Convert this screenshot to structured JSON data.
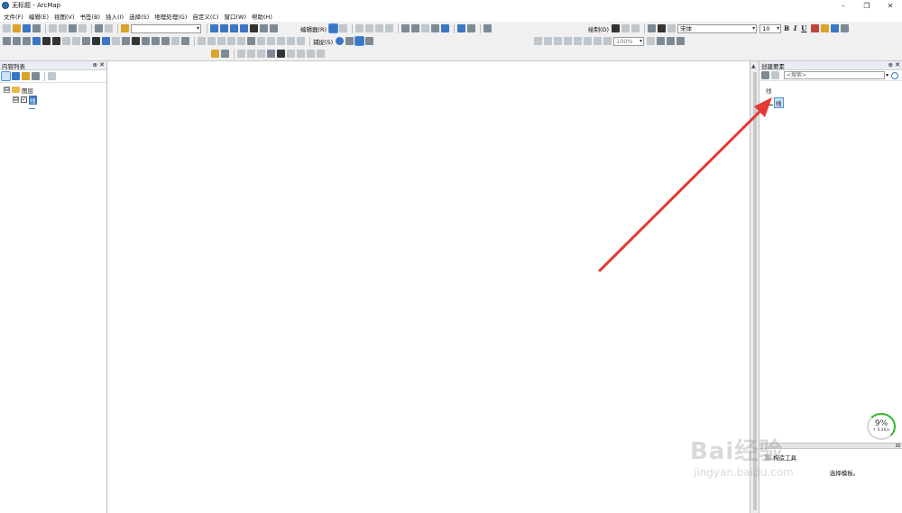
{
  "window": {
    "title": "无标题 - ArcMap",
    "minimize": "–",
    "restore": "❐",
    "close": "✕"
  },
  "menubar": [
    {
      "label": "文件(F)"
    },
    {
      "label": "编辑(E)"
    },
    {
      "label": "视图(V)"
    },
    {
      "label": "书签(B)"
    },
    {
      "label": "插入(I)"
    },
    {
      "label": "选择(S)"
    },
    {
      "label": "地理处理(G)"
    },
    {
      "label": "自定义(C)"
    },
    {
      "label": "窗口(W)"
    },
    {
      "label": "帮助(H)"
    }
  ],
  "toolbar": {
    "editor_label": "编辑器(R)",
    "snapping_label": "捕捉(S)",
    "draw_label": "绘制(D)",
    "font_name": "宋体",
    "font_size": "10",
    "bold": "B",
    "italic": "I",
    "underline": "U",
    "zoom_level": "100%",
    "scale_value": ""
  },
  "toc": {
    "title": "内容列表",
    "pin": "⊕",
    "close": "✕",
    "expander_open": "⊟",
    "data_frame": "图层",
    "layer_name": "线",
    "layer_checked": "✓"
  },
  "create_features": {
    "title": "创建要素",
    "pin": "⊕",
    "close": "✕",
    "search_placeholder": "<搜索>",
    "group_name": "线",
    "template_name": "线",
    "construction_label": "构造工具",
    "hint": "选择模板。"
  },
  "speed_widget": {
    "percent": "9%",
    "rate": "↑ 0.4K/s"
  },
  "watermark": {
    "main": "Bai经验",
    "sub": "jingyan.baidu.com"
  },
  "annotation": {
    "arrow_color": "#e53935"
  }
}
